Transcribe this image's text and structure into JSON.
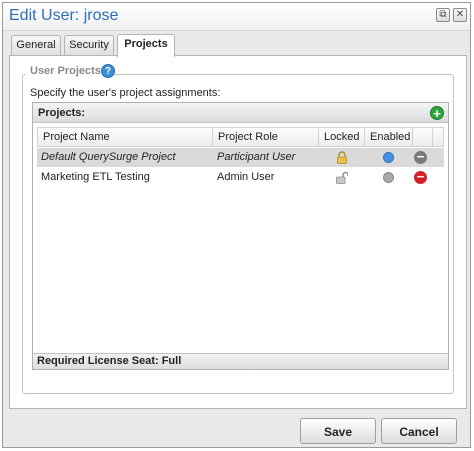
{
  "window": {
    "title": "Edit User: jrose",
    "restore_glyph": "⧉",
    "close_glyph": "✕"
  },
  "tabs": [
    {
      "label": "General"
    },
    {
      "label": "Security"
    },
    {
      "label": "Projects",
      "active": true
    }
  ],
  "section": {
    "legend": "User Projects",
    "help_glyph": "?",
    "description": "Specify the user's project assignments:"
  },
  "grid": {
    "title": "Projects:",
    "add_glyph": "+",
    "columns": [
      "Project Name",
      "Project Role",
      "Locked",
      "Enabled"
    ],
    "rows": [
      {
        "name": "Default QuerySurge Project",
        "role": "Participant User",
        "locked": true,
        "enabled": true,
        "enabled_color": "#4a90e2",
        "remove_color": "#7a7a7a",
        "selected": true
      },
      {
        "name": "Marketing ETL Testing",
        "role": "Admin User",
        "locked": false,
        "enabled": false,
        "enabled_color": "#a8a8a8",
        "remove_color": "#d0202a",
        "selected": false
      }
    ],
    "remove_glyph": "−",
    "footer": "Required License Seat: Full"
  },
  "buttons": {
    "save": "Save",
    "cancel": "Cancel"
  },
  "colors": {
    "title": "#2d6fb5",
    "lock_active": "#e8c24a",
    "lock_inactive": "#9a9a9a"
  }
}
